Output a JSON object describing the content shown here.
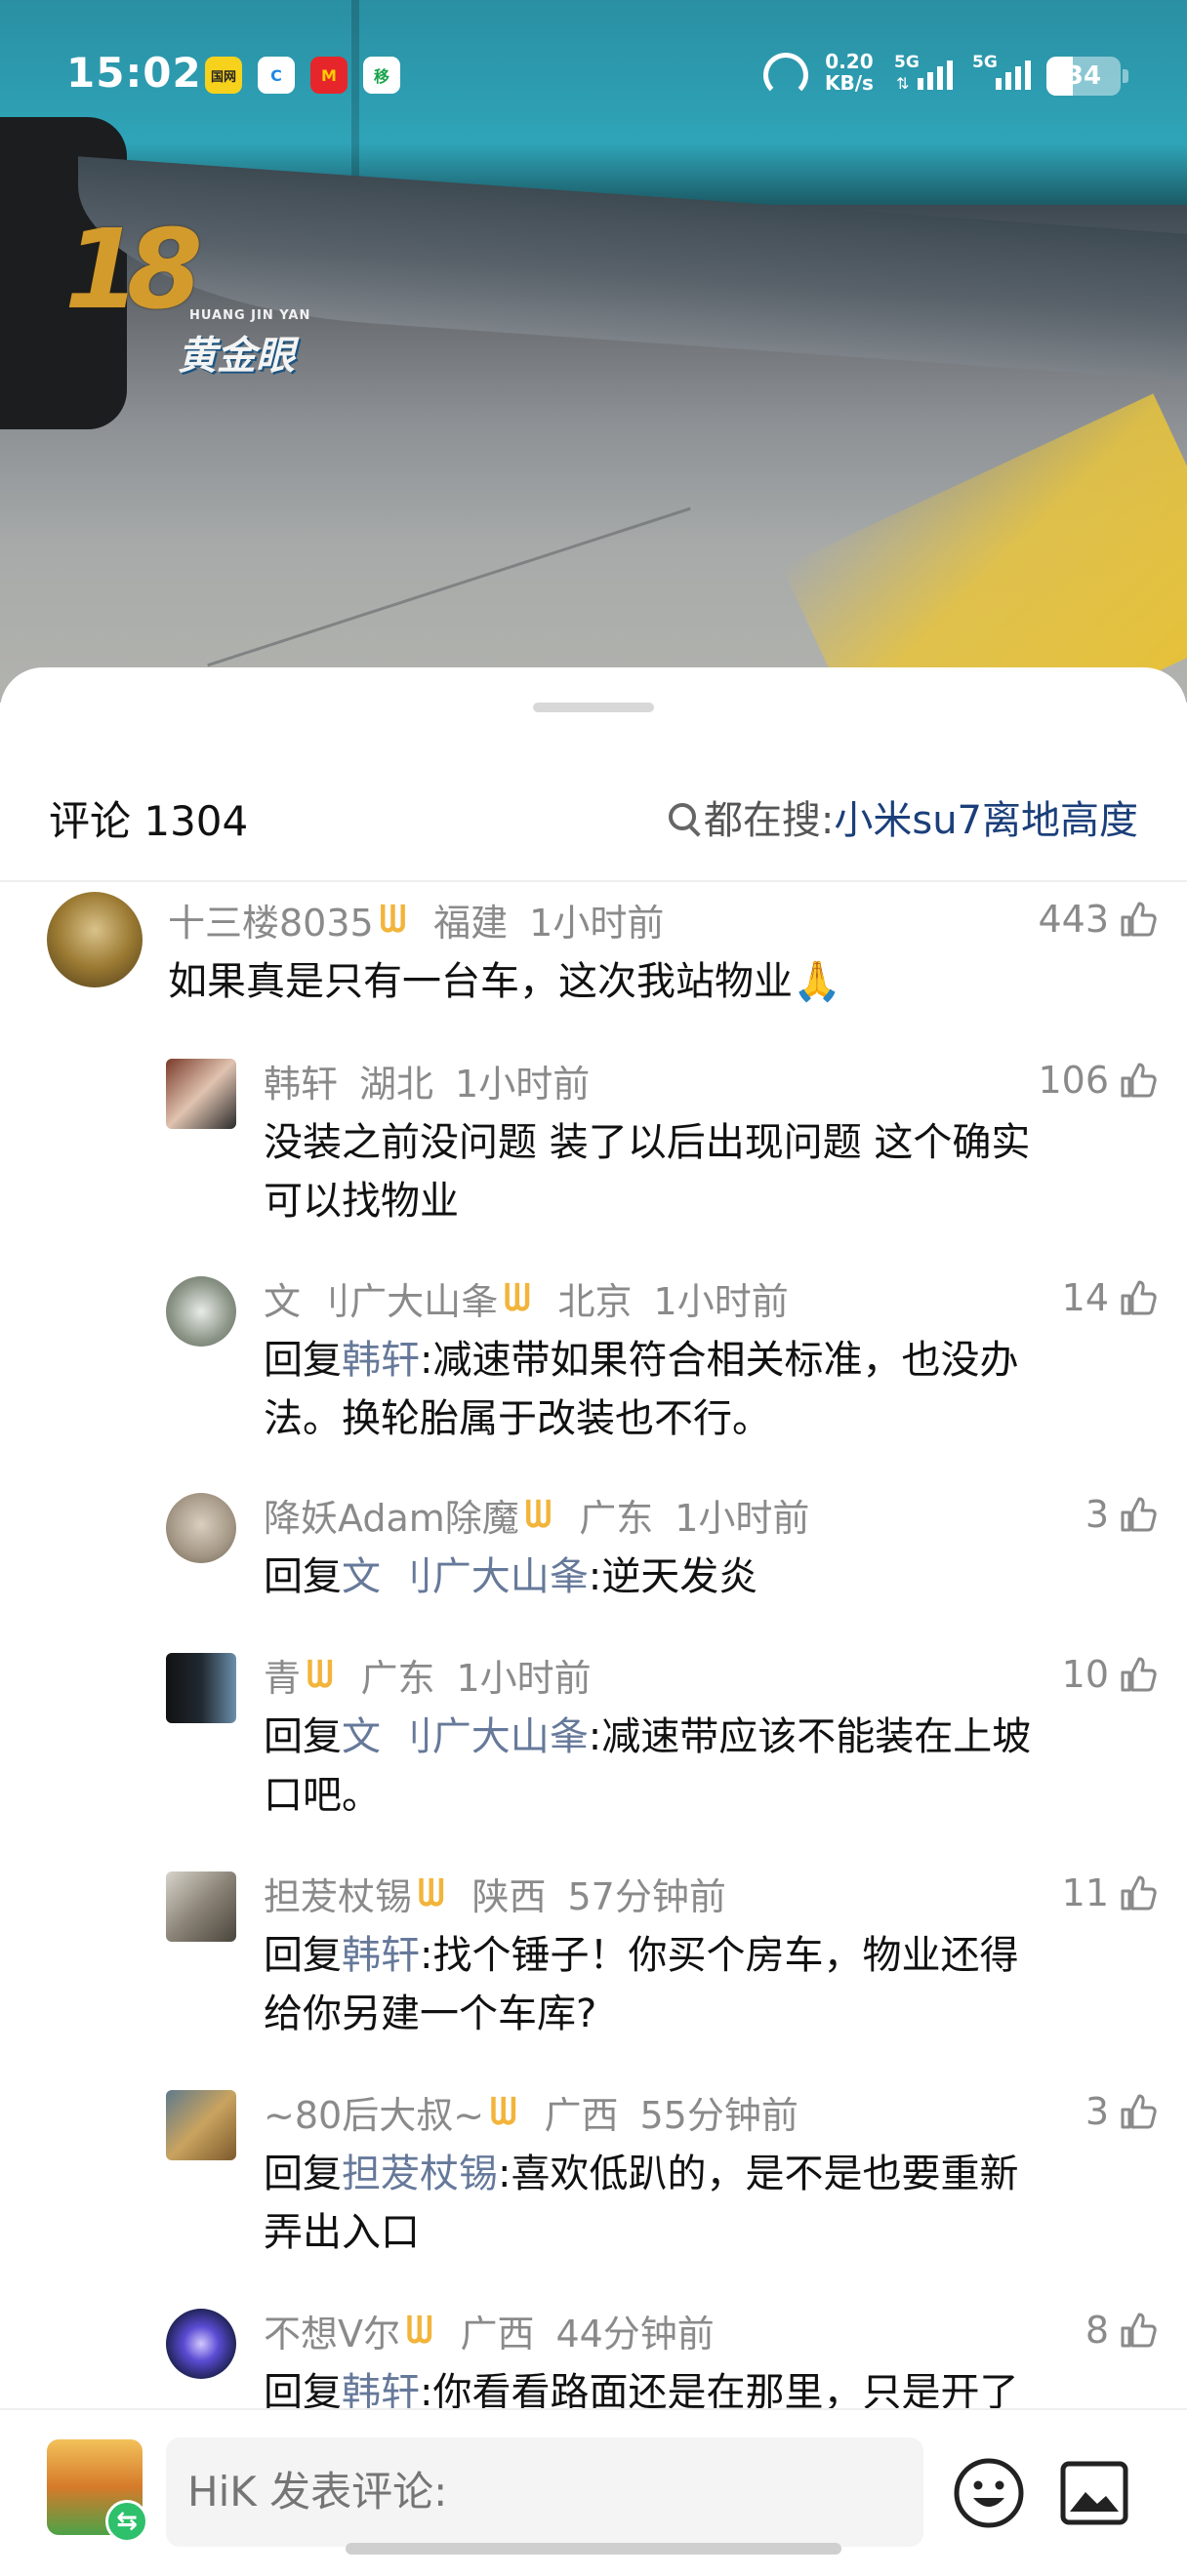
{
  "status_bar": {
    "time": "15:02",
    "app_icons": [
      "国网",
      "C",
      "M",
      "移"
    ],
    "net_speed_value": "0.20",
    "net_speed_unit": "KB/s",
    "signal_1": "5G",
    "signal_2": "5G",
    "battery": "34"
  },
  "video": {
    "logo_num": "18",
    "logo_en": "HUANG JIN YAN",
    "logo_cn": "黄金眼"
  },
  "header": {
    "title": "评论 1304",
    "search_prefix": "都在搜:",
    "search_query": "小米su7离地高度"
  },
  "comments": [
    {
      "user": "十三楼8035",
      "vip": true,
      "location": "福建",
      "time": "1小时前",
      "likes": "443",
      "reply_prefix": "",
      "reply_to": "",
      "text_lines": [
        "如果真是只有一台车，这次我站物业🙏"
      ]
    },
    {
      "user": "韩轩",
      "vip": false,
      "location": "湖北",
      "time": "1小时前",
      "likes": "106",
      "reply_prefix": "",
      "reply_to": "",
      "text_lines": [
        "没装之前没问题  装了以后出现问题 这个确实",
        "可以找物业"
      ]
    },
    {
      "user": "文 刂广大山夆",
      "vip": true,
      "location": "北京",
      "time": "1小时前",
      "likes": "14",
      "reply_prefix": "回复",
      "reply_to": "韩轩",
      "text_lines": [
        ":减速带如果符合相关标准，也没办",
        "法。换轮胎属于改装也不行。"
      ]
    },
    {
      "user": "降妖Adam除魔",
      "vip": true,
      "location": "广东",
      "time": "1小时前",
      "likes": "3",
      "reply_prefix": "回复",
      "reply_to": "文 刂广大山夆",
      "text_lines": [
        ":逆天发炎"
      ]
    },
    {
      "user": "青",
      "vip": true,
      "location": "广东",
      "time": "1小时前",
      "likes": "10",
      "reply_prefix": "回复",
      "reply_to": "文 刂广大山夆",
      "text_lines": [
        ":减速带应该不能装在上坡",
        "口吧。"
      ]
    },
    {
      "user": "担茇杖锡",
      "vip": true,
      "location": "陕西",
      "time": "57分钟前",
      "likes": "11",
      "reply_prefix": "回复",
      "reply_to": "韩轩",
      "text_lines": [
        ":找个锤子！你买个房车，物业还得",
        "给你另建一个车库?"
      ]
    },
    {
      "user": "~80后大叔~",
      "vip": true,
      "location": "广西",
      "time": "55分钟前",
      "likes": "3",
      "reply_prefix": "回复",
      "reply_to": "担茇杖锡",
      "text_lines": [
        ":喜欢低趴的，是不是也要重新",
        "弄出入口"
      ]
    },
    {
      "user": "不想V尔",
      "vip": true,
      "location": "广西",
      "time": "44分钟前",
      "likes": "8",
      "reply_prefix": "回复",
      "reply_to": "韩轩",
      "text_lines": [
        ":你看看路面还是在那里，只是开了"
      ]
    }
  ],
  "bottom_bar": {
    "input_placeholder": "HiK 发表评论:",
    "swap_icon_glyph": "⇆"
  }
}
